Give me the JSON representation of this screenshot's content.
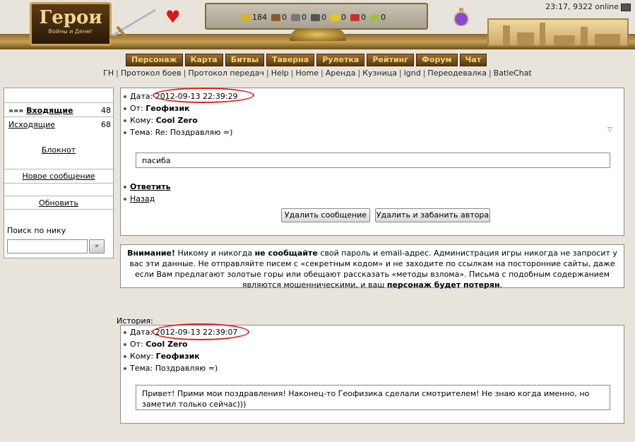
{
  "header": {
    "logo_title": "Герои",
    "logo_subtitle": "Войны и Денег",
    "clock": "23:17, 9322 online",
    "resources": [
      {
        "icon": "gold-icon",
        "value": "184",
        "color": "#d8b028"
      },
      {
        "icon": "wood-icon",
        "value": "0",
        "color": "#8a5a2a"
      },
      {
        "icon": "ore-icon",
        "value": "0",
        "color": "#777777"
      },
      {
        "icon": "mercury-icon",
        "value": "0",
        "color": "#555555"
      },
      {
        "icon": "sulfur-icon",
        "value": "0",
        "color": "#e8c820"
      },
      {
        "icon": "crystal-icon",
        "value": "0",
        "color": "#c83030"
      },
      {
        "icon": "gems-icon",
        "value": "0",
        "color": "#a0c040"
      }
    ],
    "menu": [
      "Персонаж",
      "Карта",
      "Битвы",
      "Таверна",
      "Рулетка",
      "Рейтинг",
      "Форум",
      "Чат"
    ]
  },
  "links": [
    "ГН",
    "Протокол боев",
    "Протокол передач",
    "Help",
    "Home",
    "Аренда",
    "Кузница",
    "lgnd",
    "Переодевалка",
    "BatleChat"
  ],
  "sidebar": {
    "inbox_label": "Входящие",
    "inbox_prefix": "»»»",
    "inbox_count": "48",
    "outbox_label": "Исходящие",
    "outbox_count": "68",
    "notepad": "Блокнот",
    "new_message": "Новое сообщение",
    "refresh": "Обновить",
    "search_label": "Поиск по нику",
    "search_value": ""
  },
  "message": {
    "date_label": "Дата:",
    "date": "2012-09-13 22:39:29",
    "from_label": "От:",
    "from": "Геофизик",
    "to_label": "Кому:",
    "to": "Cool Zero",
    "subject_label": "Тема:",
    "subject": "Re: Поздравляю =)",
    "body": "пасиба",
    "reply": "Ответить",
    "back": "Назад",
    "delete_btn": "Удалить сообщение",
    "delete_ban_btn": "Удалить и забанить автора"
  },
  "warning": {
    "t1": "Внимание!",
    "t2": " Никому и никогда ",
    "t3": "не сообщайте",
    "t4": " свой пароль и email-адрес. Администрация игры никогда не запросит у вас эти данные. Не отправляйте писем с «секретным кодом» и не заходите по ссылкам на посторонние сайты, даже если Вам предлагают золотые горы или обещают рассказать «методы взлома». Письма с подобным содержанием являются мошенническими, и ваш ",
    "t5": "персонаж будет потерян",
    "t6": "."
  },
  "history": {
    "label": "История:",
    "date_label": "Дата:",
    "date": "2012-09-13 22:39:07",
    "from_label": "От:",
    "from": "Cool Zero",
    "to_label": "Кому:",
    "to": "Геофизик",
    "subject_label": "Тема:",
    "subject": "Поздравляю =)",
    "body": "Привет! Прими мои поздравления! Наконец-то Геофизика сделали смотрителем! Не знаю когда именно, но заметил только сейчас)))"
  },
  "colors": {
    "highlight_oval": "#e02020",
    "menu_text": "#f4d27a"
  }
}
